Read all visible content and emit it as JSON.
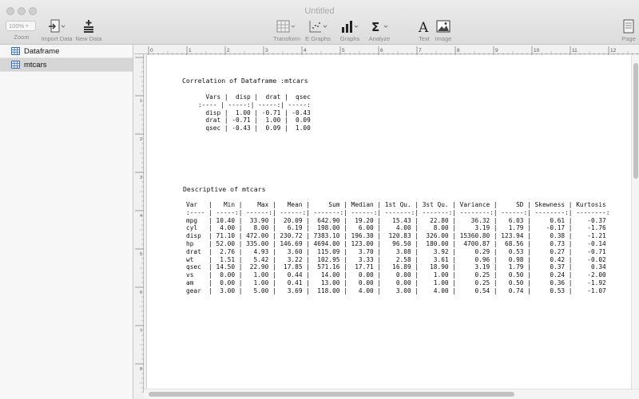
{
  "window": {
    "title": "Untitled"
  },
  "toolbar": {
    "zoom": {
      "value": "100%",
      "label": "Zoom"
    },
    "import_data": {
      "label": "Import Data"
    },
    "new_data": {
      "label": "New Data"
    },
    "transform": {
      "label": "Transform"
    },
    "e_graphs": {
      "label": "E Graphs"
    },
    "graphs": {
      "label": "Graphs"
    },
    "analyze": {
      "label": "Analyze"
    },
    "text": {
      "label": "Text"
    },
    "image": {
      "label": "Image"
    },
    "page": {
      "label": "Page"
    }
  },
  "sidebar": {
    "items": [
      {
        "label": "Dataframe",
        "selected": false
      },
      {
        "label": "mtcars",
        "selected": true
      }
    ]
  },
  "ruler": {
    "ticks": [
      "0",
      "1",
      "2",
      "3",
      "4",
      "5",
      "6",
      "7",
      "8",
      "9",
      "10",
      "11",
      "12"
    ]
  },
  "document": {
    "correlation_title": "Correlation of Dataframe :mtcars",
    "correlation_table": "  Vars |  disp |  drat |  qsec\n:---- | -----:| -----:| -----:\n  disp |  1.00 | -0.71 | -0.43\n  drat | -0.71 |  1.00 |  0.09\n  qsec | -0.43 |  0.09 |  1.00",
    "descriptive_title": "Descriptive of mtcars",
    "descriptive_table": "Var   |   Min |    Max |   Mean |     Sum | Median | 1st Qu. | 3st Qu. | Variance |     SD | Skewness | Kurtosis\n:---- | -----:| ------:| ------:| -------:| ------:| -------:| -------:| --------:| ------:| --------:| --------:\nmpg   | 10.40 |  33.90 |  20.09 |  642.90 |  19.20 |   15.43 |   22.80 |    36.32 |   6.03 |     0.61 |    -0.37\ncyl   |  4.00 |   8.00 |   6.19 |  198.00 |   6.00 |    4.00 |    8.00 |     3.19 |   1.79 |    -0.17 |    -1.76\ndisp  | 71.10 | 472.00 | 230.72 | 7383.10 | 196.30 |  120.83 |  326.00 | 15360.80 | 123.94 |     0.38 |    -1.21\nhp    | 52.00 | 335.00 | 146.69 | 4694.00 | 123.00 |   96.50 |  180.00 |  4700.87 |  68.56 |     0.73 |    -0.14\ndrat  |  2.76 |   4.93 |   3.60 |  115.09 |   3.70 |    3.08 |    3.92 |     0.29 |   0.53 |     0.27 |    -0.71\nwt    |  1.51 |   5.42 |   3.22 |  102.95 |   3.33 |    2.58 |    3.61 |     0.96 |   0.98 |     0.42 |    -0.02\nqsec  | 14.50 |  22.90 |  17.85 |  571.16 |  17.71 |   16.89 |   18.90 |     3.19 |   1.79 |     0.37 |     0.34\nvs    |  0.00 |   1.00 |   0.44 |   14.00 |   0.00 |    0.00 |    1.00 |     0.25 |   0.50 |     0.24 |    -2.00\nam    |  0.00 |   1.00 |   0.41 |   13.00 |   0.00 |    0.00 |    1.00 |     0.25 |   0.50 |     0.36 |    -1.92\ngear  |  3.00 |   5.00 |   3.69 |  118.00 |   4.00 |    3.00 |    4.00 |     0.54 |   0.74 |     0.53 |    -1.07"
  }
}
